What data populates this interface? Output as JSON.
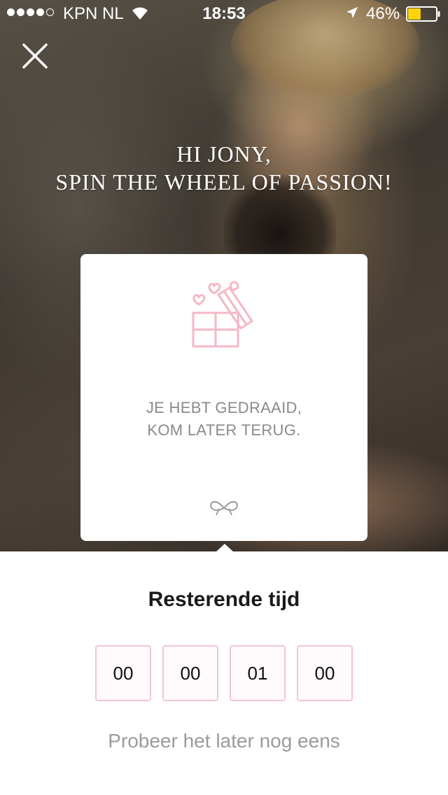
{
  "status_bar": {
    "carrier": "KPN NL",
    "time": "18:53",
    "battery_percent": "46%",
    "battery_level": 0.46,
    "signal_strength": 4,
    "signal_max": 5
  },
  "header": {
    "close_icon": "close-icon",
    "title_line1": "HI JONY,",
    "title_line2": "SPIN THE WHEEL OF PASSION!"
  },
  "card": {
    "icon": "gift-hearts-icon",
    "message_line1": "JE HEBT GEDRAAID,",
    "message_line2": "KOM LATER TERUG.",
    "footer_icon": "bow-icon"
  },
  "countdown": {
    "title": "Resterende tijd",
    "digits": [
      "00",
      "00",
      "01",
      "00"
    ]
  },
  "retry_text": "Probeer het later nog eens",
  "colors": {
    "accent_pink": "#f2c6cf",
    "icon_pink": "#f4b8c6",
    "muted_text": "#8a8a8a"
  }
}
